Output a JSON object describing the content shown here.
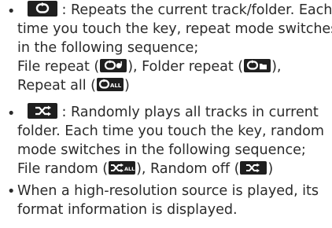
{
  "items": [
    {
      "bullet": "•",
      "icon_repeat_name": "repeat-key-icon",
      "line1_text": " : Repeats the current track/folder. Each",
      "line2_text": "time you touch the key, repeat mode switches",
      "line3_text": "in the following sequence;",
      "line4": {
        "label_file_repeat": "File repeat (",
        "close1": "), Folder repeat (",
        "close2": "),"
      },
      "line5": {
        "label_repeat_all": "Repeat all (",
        "close": ")"
      },
      "icon_file_repeat_name": "file-repeat-icon",
      "icon_folder_repeat_name": "folder-repeat-icon",
      "icon_repeat_all_name": "repeat-all-icon",
      "repeat_all_icon_text": "ALL"
    },
    {
      "bullet": "•",
      "line1_text": " : Randomly plays all tracks in current",
      "line2_text": "folder. Each time you touch the key, random",
      "line3_text": "mode switches in the following sequence;",
      "line4": {
        "label_file_random": "File random (",
        "close1": "), Random off (",
        "close2": ")"
      },
      "random_all_icon_text": "ALL"
    },
    {
      "bullet": "•",
      "line1_text": "When a high-resolution source is played, its",
      "line2_text": "format information is displayed."
    }
  ],
  "colors": {
    "text": "#2b2b2b",
    "icon_bg": "#1f1f1f",
    "icon_fg": "#ffffff"
  }
}
